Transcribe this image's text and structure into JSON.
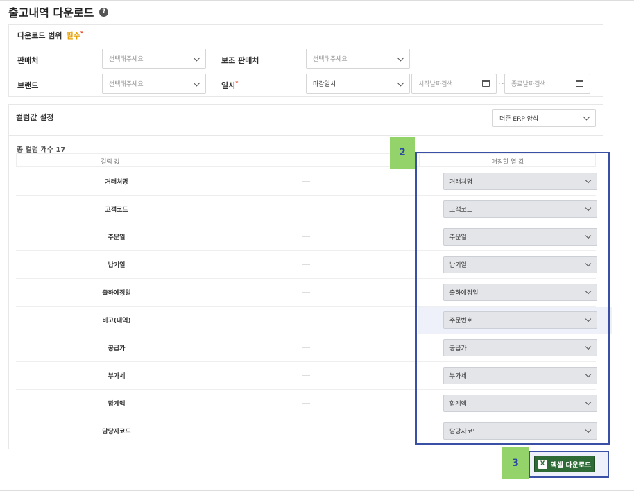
{
  "page": {
    "title": "출고내역 다운로드",
    "help_icon": "question-circle-icon"
  },
  "range": {
    "header": "다운로드 범위",
    "required": "필수",
    "required_mark": "*",
    "seller": {
      "label": "판매처",
      "placeholder": "선택해주세요"
    },
    "sub_seller": {
      "label": "보조 판매처",
      "placeholder": "선택해주세요"
    },
    "brand": {
      "label": "브랜드",
      "placeholder": "선택해주세요"
    },
    "date": {
      "label": "일시",
      "mark": "*",
      "type_value": "마감일시",
      "start_placeholder": "시작날짜검색",
      "separator": "~",
      "end_placeholder": "종료날짜검색"
    }
  },
  "column_settings": {
    "title": "컬럼값 설정",
    "preset": "더존 ERP 양식"
  },
  "mapping": {
    "total": "총 컬럼 개수 17",
    "col_header": "컬럼 값",
    "match_header": "매칭할 열 값",
    "rows": [
      {
        "name": "거래처명",
        "value": "거래처명"
      },
      {
        "name": "고객코드",
        "value": "고객코드"
      },
      {
        "name": "주문일",
        "value": "주문일"
      },
      {
        "name": "납기일",
        "value": "납기일"
      },
      {
        "name": "출하예정일",
        "value": "출하예정일"
      },
      {
        "name": "비고(내역)",
        "value": "주문번호"
      },
      {
        "name": "공급가",
        "value": "공급가"
      },
      {
        "name": "부가세",
        "value": "부가세"
      },
      {
        "name": "합계액",
        "value": "합계액"
      },
      {
        "name": "담당자코드",
        "value": "담당자코드"
      }
    ]
  },
  "annotations": {
    "step2": "2",
    "step3": "3"
  },
  "download": {
    "label": "엑셀 다운로드",
    "icon": "excel-icon",
    "icon_glyph": "X"
  },
  "colors": {
    "download_button": "#2f6b36",
    "annotation_frame": "#3a4fa6",
    "annotation_badge": "#94d36a"
  }
}
